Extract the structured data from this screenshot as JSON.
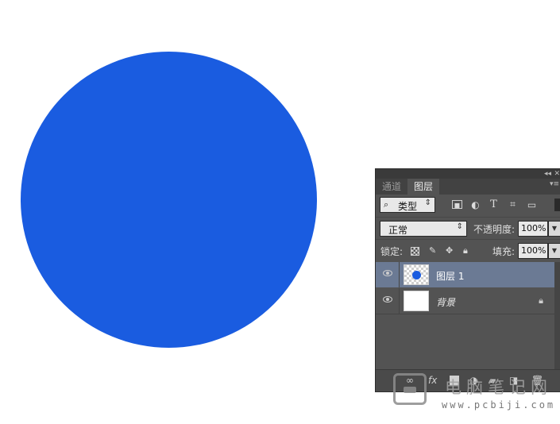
{
  "canvas": {
    "shape_color": "#1a5ce0",
    "background": "#ffffff"
  },
  "panel": {
    "icons": {
      "collapse": "double-chevron-icon",
      "close": "close-icon",
      "menu": "panel-menu-icon"
    },
    "tabs": [
      {
        "label": "通道",
        "active": false
      },
      {
        "label": "图层",
        "active": true
      }
    ],
    "filter": {
      "kind_label": "类型",
      "icons": [
        "image-filter-icon",
        "adjustment-filter-icon",
        "type-filter-icon",
        "shape-filter-icon",
        "smart-object-filter-icon"
      ]
    },
    "blend": {
      "mode": "正常",
      "opacity_label": "不透明度:",
      "opacity_value": "100%"
    },
    "lock": {
      "label": "锁定:",
      "icons": [
        "lock-pixels-icon",
        "lock-image-icon",
        "lock-position-icon",
        "lock-all-icon"
      ],
      "fill_label": "填充:",
      "fill_value": "100%"
    },
    "layers": [
      {
        "name": "图层 1",
        "selected": true,
        "visible": true
      },
      {
        "name": "背景",
        "selected": false,
        "visible": true,
        "locked": true
      }
    ],
    "bottom_icons": [
      "link-layers-icon",
      "fx-icon",
      "add-mask-icon",
      "new-adjustment-icon",
      "new-group-icon",
      "new-layer-icon",
      "trash-icon"
    ],
    "fx_label": "fx"
  },
  "watermark": {
    "title": "电脑笔记网",
    "url": "www.pcbiji.com"
  }
}
